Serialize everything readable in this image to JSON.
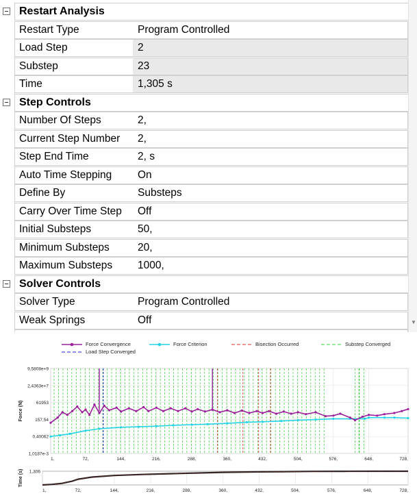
{
  "details": {
    "groups": [
      {
        "title": "Restart Analysis",
        "props": [
          {
            "name": "Restart Type",
            "value": "Program Controlled",
            "readonly": false
          },
          {
            "name": "Load Step",
            "value": "2",
            "readonly": true
          },
          {
            "name": "Substep",
            "value": "23",
            "readonly": true
          },
          {
            "name": "Time",
            "value": "1,305 s",
            "readonly": true
          }
        ]
      },
      {
        "title": "Step Controls",
        "props": [
          {
            "name": "Number Of Steps",
            "value": "2,",
            "readonly": false
          },
          {
            "name": "Current Step Number",
            "value": "2,",
            "readonly": false
          },
          {
            "name": "Step End Time",
            "value": "2, s",
            "readonly": false
          },
          {
            "name": "Auto Time Stepping",
            "value": "On",
            "readonly": false
          },
          {
            "name": "Define By",
            "value": "Substeps",
            "readonly": false
          },
          {
            "name": "Carry Over Time Step",
            "value": "Off",
            "readonly": false
          },
          {
            "name": "Initial Substeps",
            "value": "50,",
            "readonly": false
          },
          {
            "name": "Minimum Substeps",
            "value": "20,",
            "readonly": false
          },
          {
            "name": "Maximum Substeps",
            "value": "1000,",
            "readonly": false
          }
        ]
      },
      {
        "title": "Solver Controls",
        "props": [
          {
            "name": "Solver Type",
            "value": "Program Controlled",
            "readonly": false
          },
          {
            "name": "Weak Springs",
            "value": "Off",
            "readonly": false
          }
        ]
      }
    ]
  },
  "chart_data": [
    {
      "type": "line",
      "title": "",
      "xlabel": "",
      "ylabel": "Force (N)",
      "y_scale": "log",
      "y_ticks": [
        "9,5808e+9",
        "2,4363e+7",
        "61953",
        "157,54",
        "0,40062",
        "1,0187e-3"
      ],
      "x_ticks": [
        "1,",
        "72,",
        "144,",
        "216,",
        "288,",
        "360,",
        "432,",
        "504,",
        "576,",
        "648,",
        "728,"
      ],
      "xlim": [
        1,
        728
      ],
      "grid": true,
      "legend_position": "top",
      "legend": [
        {
          "name": "Force Convergence",
          "color": "#9b1f9b",
          "style": "line-marker"
        },
        {
          "name": "Force Criterion",
          "color": "#22d3e6",
          "style": "line-marker"
        },
        {
          "name": "Bisection Occurred",
          "color": "#e8282e",
          "style": "dash"
        },
        {
          "name": "Substep Converged",
          "color": "#32cd32",
          "style": "dash"
        },
        {
          "name": "Load Step Converged",
          "color": "#2020d8",
          "style": "dash"
        }
      ],
      "series": [
        {
          "name": "Force Convergence",
          "x": [
            1,
            15,
            25,
            35,
            45,
            55,
            65,
            72,
            80,
            90,
            100,
            110,
            120,
            135,
            144,
            160,
            175,
            190,
            200,
            216,
            230,
            245,
            260,
            275,
            288,
            300,
            315,
            330,
            345,
            360,
            375,
            390,
            405,
            420,
            432,
            445,
            460,
            475,
            490,
            504,
            520,
            540,
            560,
            576,
            590,
            610,
            620,
            635,
            648,
            665,
            680,
            700,
            715,
            728
          ],
          "y": [
            50,
            300,
            2000,
            800,
            3000,
            15000,
            2000,
            5000,
            800,
            30000,
            1500,
            20000,
            4000,
            10000,
            2500,
            8000,
            3000,
            12000,
            3000,
            10000,
            3000,
            8000,
            3000,
            8000,
            2500,
            6000,
            2500,
            5000,
            2000,
            4000,
            1500,
            3500,
            1500,
            3000,
            1500,
            3000,
            1200,
            2500,
            1200,
            2000,
            1000,
            2000,
            500,
            600,
            1200,
            300,
            120,
            400,
            800,
            600,
            1000,
            1500,
            3000,
            6000
          ]
        },
        {
          "name": "Force Criterion",
          "x": [
            1,
            20,
            40,
            72,
            100,
            144,
            180,
            216,
            250,
            288,
            320,
            360,
            400,
            432,
            470,
            504,
            540,
            576,
            610,
            640,
            648,
            680,
            700,
            728
          ],
          "y": [
            0.4,
            0.6,
            1,
            3,
            6,
            10,
            12,
            15,
            20,
            25,
            30,
            40,
            60,
            70,
            90,
            120,
            150,
            200,
            200,
            200,
            300,
            300,
            300,
            250
          ]
        }
      ],
      "markers": {
        "load_step_converged_x": [
          108
        ],
        "bisection_occurred_x": [
          340,
          392,
          424,
          448
        ]
      }
    },
    {
      "type": "line",
      "title": "",
      "xlabel": "",
      "ylabel": "Time (s)",
      "y_ticks": [
        "1,306"
      ],
      "x_ticks": [
        "1,",
        "72,",
        "144,",
        "216,",
        "288,",
        "360,",
        "432,",
        "504,",
        "576,",
        "648,",
        "728,"
      ],
      "xlim": [
        1,
        728
      ],
      "ylim": [
        0,
        1.306
      ],
      "series": [
        {
          "name": "Time",
          "x": [
            1,
            20,
            40,
            60,
            72,
            100,
            144,
            200,
            260,
            320,
            360,
            420,
            480,
            540,
            600,
            660,
            728
          ],
          "y": [
            0.0,
            0.05,
            0.15,
            0.35,
            0.55,
            0.75,
            0.9,
            1.0,
            1.08,
            1.15,
            1.2,
            1.24,
            1.27,
            1.29,
            1.3,
            1.305,
            1.306
          ]
        }
      ]
    }
  ]
}
